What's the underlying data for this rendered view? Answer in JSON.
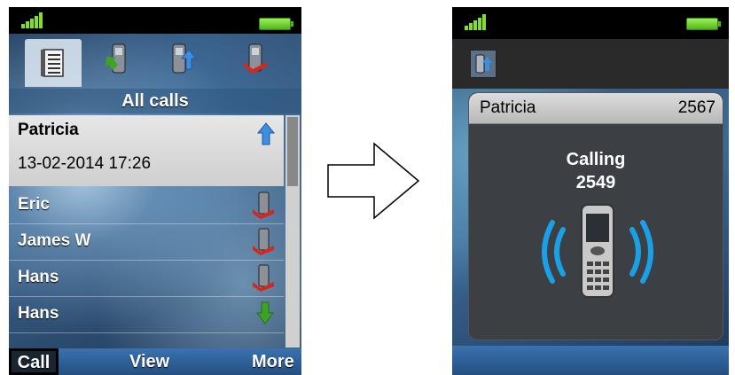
{
  "left_screen": {
    "tabs": [
      {
        "name": "all-calls-tab",
        "icon": "list-icon",
        "selected": true
      },
      {
        "name": "received-calls-tab",
        "icon": "incoming-call-icon",
        "selected": false
      },
      {
        "name": "dialed-calls-tab",
        "icon": "outgoing-call-icon",
        "selected": false
      },
      {
        "name": "missed-calls-tab",
        "icon": "missed-call-icon",
        "selected": false
      }
    ],
    "title": "All calls",
    "selected_entry": {
      "name": "Patricia",
      "datetime": "13-02-2014 17:26",
      "icon": "outgoing-arrow-icon"
    },
    "entries": [
      {
        "name": "Eric",
        "icon": "missed-call-icon"
      },
      {
        "name": "James W",
        "icon": "missed-call-icon"
      },
      {
        "name": "Hans",
        "icon": "missed-call-icon"
      },
      {
        "name": "Hans",
        "icon": "incoming-arrow-icon"
      }
    ],
    "softkeys": {
      "left": "Call",
      "middle": "View",
      "right": "More"
    }
  },
  "right_screen": {
    "header_icon": "outgoing-call-icon",
    "contact_name": "Patricia",
    "contact_number": "2567",
    "status": "Calling",
    "dialed_number": "2549",
    "graphic": "ringing-phone-icon"
  },
  "colors": {
    "signal": "#7ee02a",
    "battery": "#4fb617",
    "softkey_bar": "#2f5f96",
    "ring_waves": "#19a0e6",
    "outgoing_arrow": "#3d8ee0",
    "incoming_arrow": "#3ea324",
    "missed_red": "#d9261c"
  }
}
